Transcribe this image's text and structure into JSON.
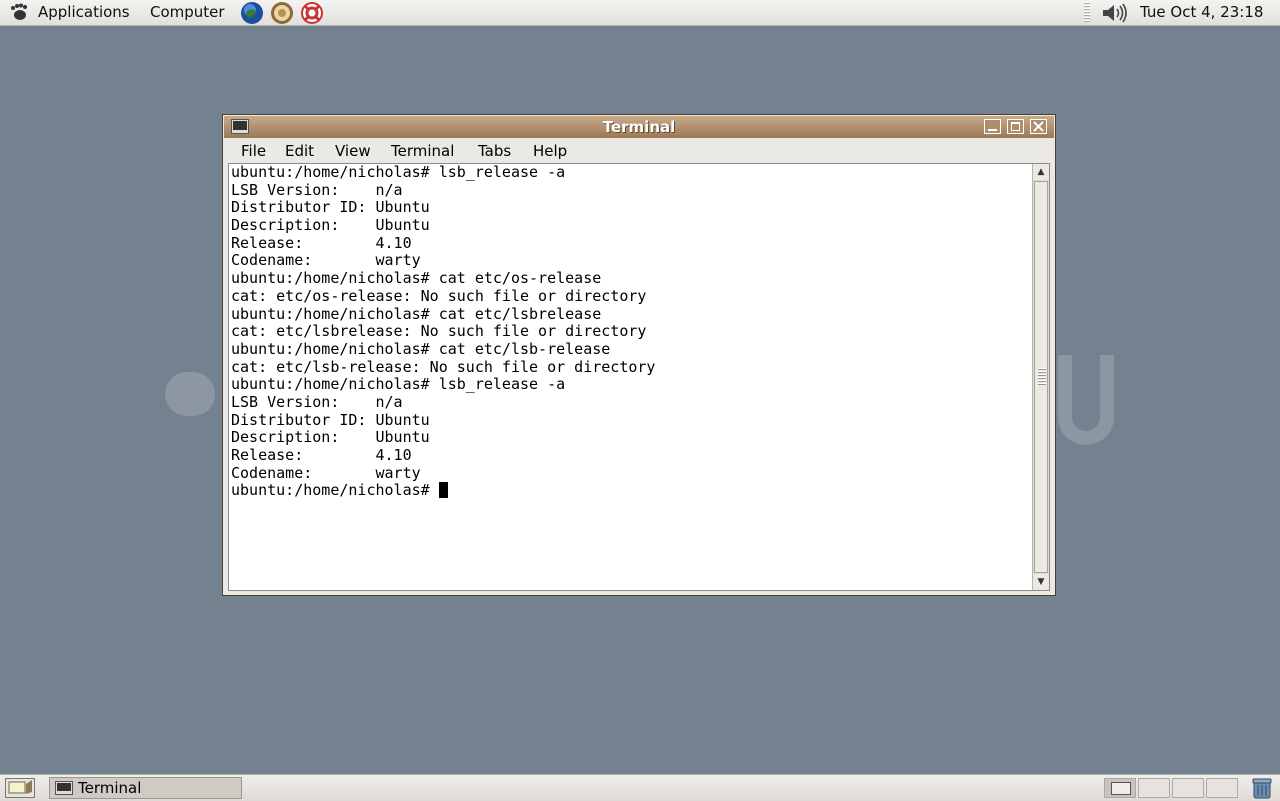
{
  "top_panel": {
    "applications_label": "Applications",
    "computer_label": "Computer",
    "launchers": [
      "web-browser-icon",
      "email-client-icon",
      "help-icon"
    ],
    "volume_icon": "speaker-icon",
    "clock": "Tue Oct  4, 23:18"
  },
  "terminal_window": {
    "title": "Terminal",
    "menu": [
      "File",
      "Edit",
      "View",
      "Terminal",
      "Tabs",
      "Help"
    ],
    "lines": [
      "ubuntu:/home/nicholas# lsb_release -a",
      "LSB Version:    n/a",
      "Distributor ID: Ubuntu",
      "Description:    Ubuntu",
      "Release:        4.10",
      "Codename:       warty",
      "ubuntu:/home/nicholas# cat etc/os-release",
      "cat: etc/os-release: No such file or directory",
      "ubuntu:/home/nicholas# cat etc/lsbrelease",
      "cat: etc/lsbrelease: No such file or directory",
      "ubuntu:/home/nicholas# cat etc/lsb-release",
      "cat: etc/lsb-release: No such file or directory",
      "ubuntu:/home/nicholas# lsb_release -a",
      "LSB Version:    n/a",
      "Distributor ID: Ubuntu",
      "Description:    Ubuntu",
      "Release:        4.10",
      "Codename:       warty"
    ],
    "prompt": "ubuntu:/home/nicholas# "
  },
  "bottom_panel": {
    "taskbar_item": "Terminal",
    "workspaces": 4,
    "active_workspace": 1
  },
  "colors": {
    "desktop": "#748290",
    "titlebar": "#b08f6e",
    "panel": "#e9e7e3"
  }
}
